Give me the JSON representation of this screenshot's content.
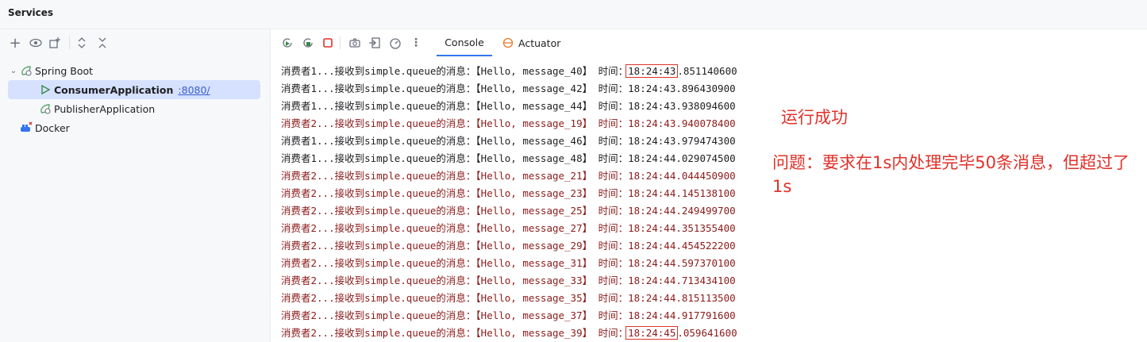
{
  "panel": {
    "title": "Services"
  },
  "left_toolbar": {
    "add": "+",
    "eye": "◉",
    "new_group": "⊞",
    "expand": "⌃",
    "collapse": "⌄"
  },
  "tree": {
    "spring_boot": "Spring Boot",
    "consumer": {
      "name": "ConsumerApplication",
      "port": ":8080/"
    },
    "publisher": "PublisherApplication",
    "docker": "Docker"
  },
  "tabs": {
    "console": "Console",
    "actuator": "Actuator"
  },
  "console_lines": [
    {
      "consumer": "消费者1",
      "msg": "【Hello, message_40】",
      "time": "18:24:43",
      "frac": ".851140600",
      "color": "c1"
    },
    {
      "consumer": "消费者1",
      "msg": "【Hello, message_42】",
      "time": "18:24:43",
      "frac": ".896430900",
      "color": "c1"
    },
    {
      "consumer": "消费者1",
      "msg": "【Hello, message_44】",
      "time": "18:24:43",
      "frac": ".938094600",
      "color": "c1"
    },
    {
      "consumer": "消费者2",
      "msg": "【Hello, message_19】",
      "time": "18:24:43",
      "frac": ".940078400",
      "color": "c2"
    },
    {
      "consumer": "消费者1",
      "msg": "【Hello, message_46】",
      "time": "18:24:43",
      "frac": ".979474300",
      "color": "c1"
    },
    {
      "consumer": "消费者1",
      "msg": "【Hello, message_48】",
      "time": "18:24:44",
      "frac": ".029074500",
      "color": "c1"
    },
    {
      "consumer": "消费者2",
      "msg": "【Hello, message_21】",
      "time": "18:24:44",
      "frac": ".044450900",
      "color": "c2"
    },
    {
      "consumer": "消费者2",
      "msg": "【Hello, message_23】",
      "time": "18:24:44",
      "frac": ".145138100",
      "color": "c2"
    },
    {
      "consumer": "消费者2",
      "msg": "【Hello, message_25】",
      "time": "18:24:44",
      "frac": ".249499700",
      "color": "c2"
    },
    {
      "consumer": "消费者2",
      "msg": "【Hello, message_27】",
      "time": "18:24:44",
      "frac": ".351355400",
      "color": "c2"
    },
    {
      "consumer": "消费者2",
      "msg": "【Hello, message_29】",
      "time": "18:24:44",
      "frac": ".454522200",
      "color": "c2"
    },
    {
      "consumer": "消费者2",
      "msg": "【Hello, message_31】",
      "time": "18:24:44",
      "frac": ".597370100",
      "color": "c2"
    },
    {
      "consumer": "消费者2",
      "msg": "【Hello, message_33】",
      "time": "18:24:44",
      "frac": ".713434100",
      "color": "c2"
    },
    {
      "consumer": "消费者2",
      "msg": "【Hello, message_35】",
      "time": "18:24:44",
      "frac": ".815113500",
      "color": "c2"
    },
    {
      "consumer": "消费者2",
      "msg": "【Hello, message_37】",
      "time": "18:24:44",
      "frac": ".917791600",
      "color": "c2"
    },
    {
      "consumer": "消费者2",
      "msg": "【Hello, message_39】",
      "time": "18:24:45",
      "frac": ".059641600",
      "color": "c2"
    }
  ],
  "console_text": {
    "middle": "...接收到simple.queue的消息：",
    "time_label": " 时间："
  },
  "annotations": {
    "success": "运行成功",
    "problem": "问题：要求在1s内处理完毕50条消息，但超过了1s"
  },
  "colors": {
    "consumer1": "#1e1f22",
    "consumer2": "#8c1b1b",
    "annotation_red": "#e0312a",
    "selection": "#d5e1ff",
    "accent": "#3574f0"
  }
}
